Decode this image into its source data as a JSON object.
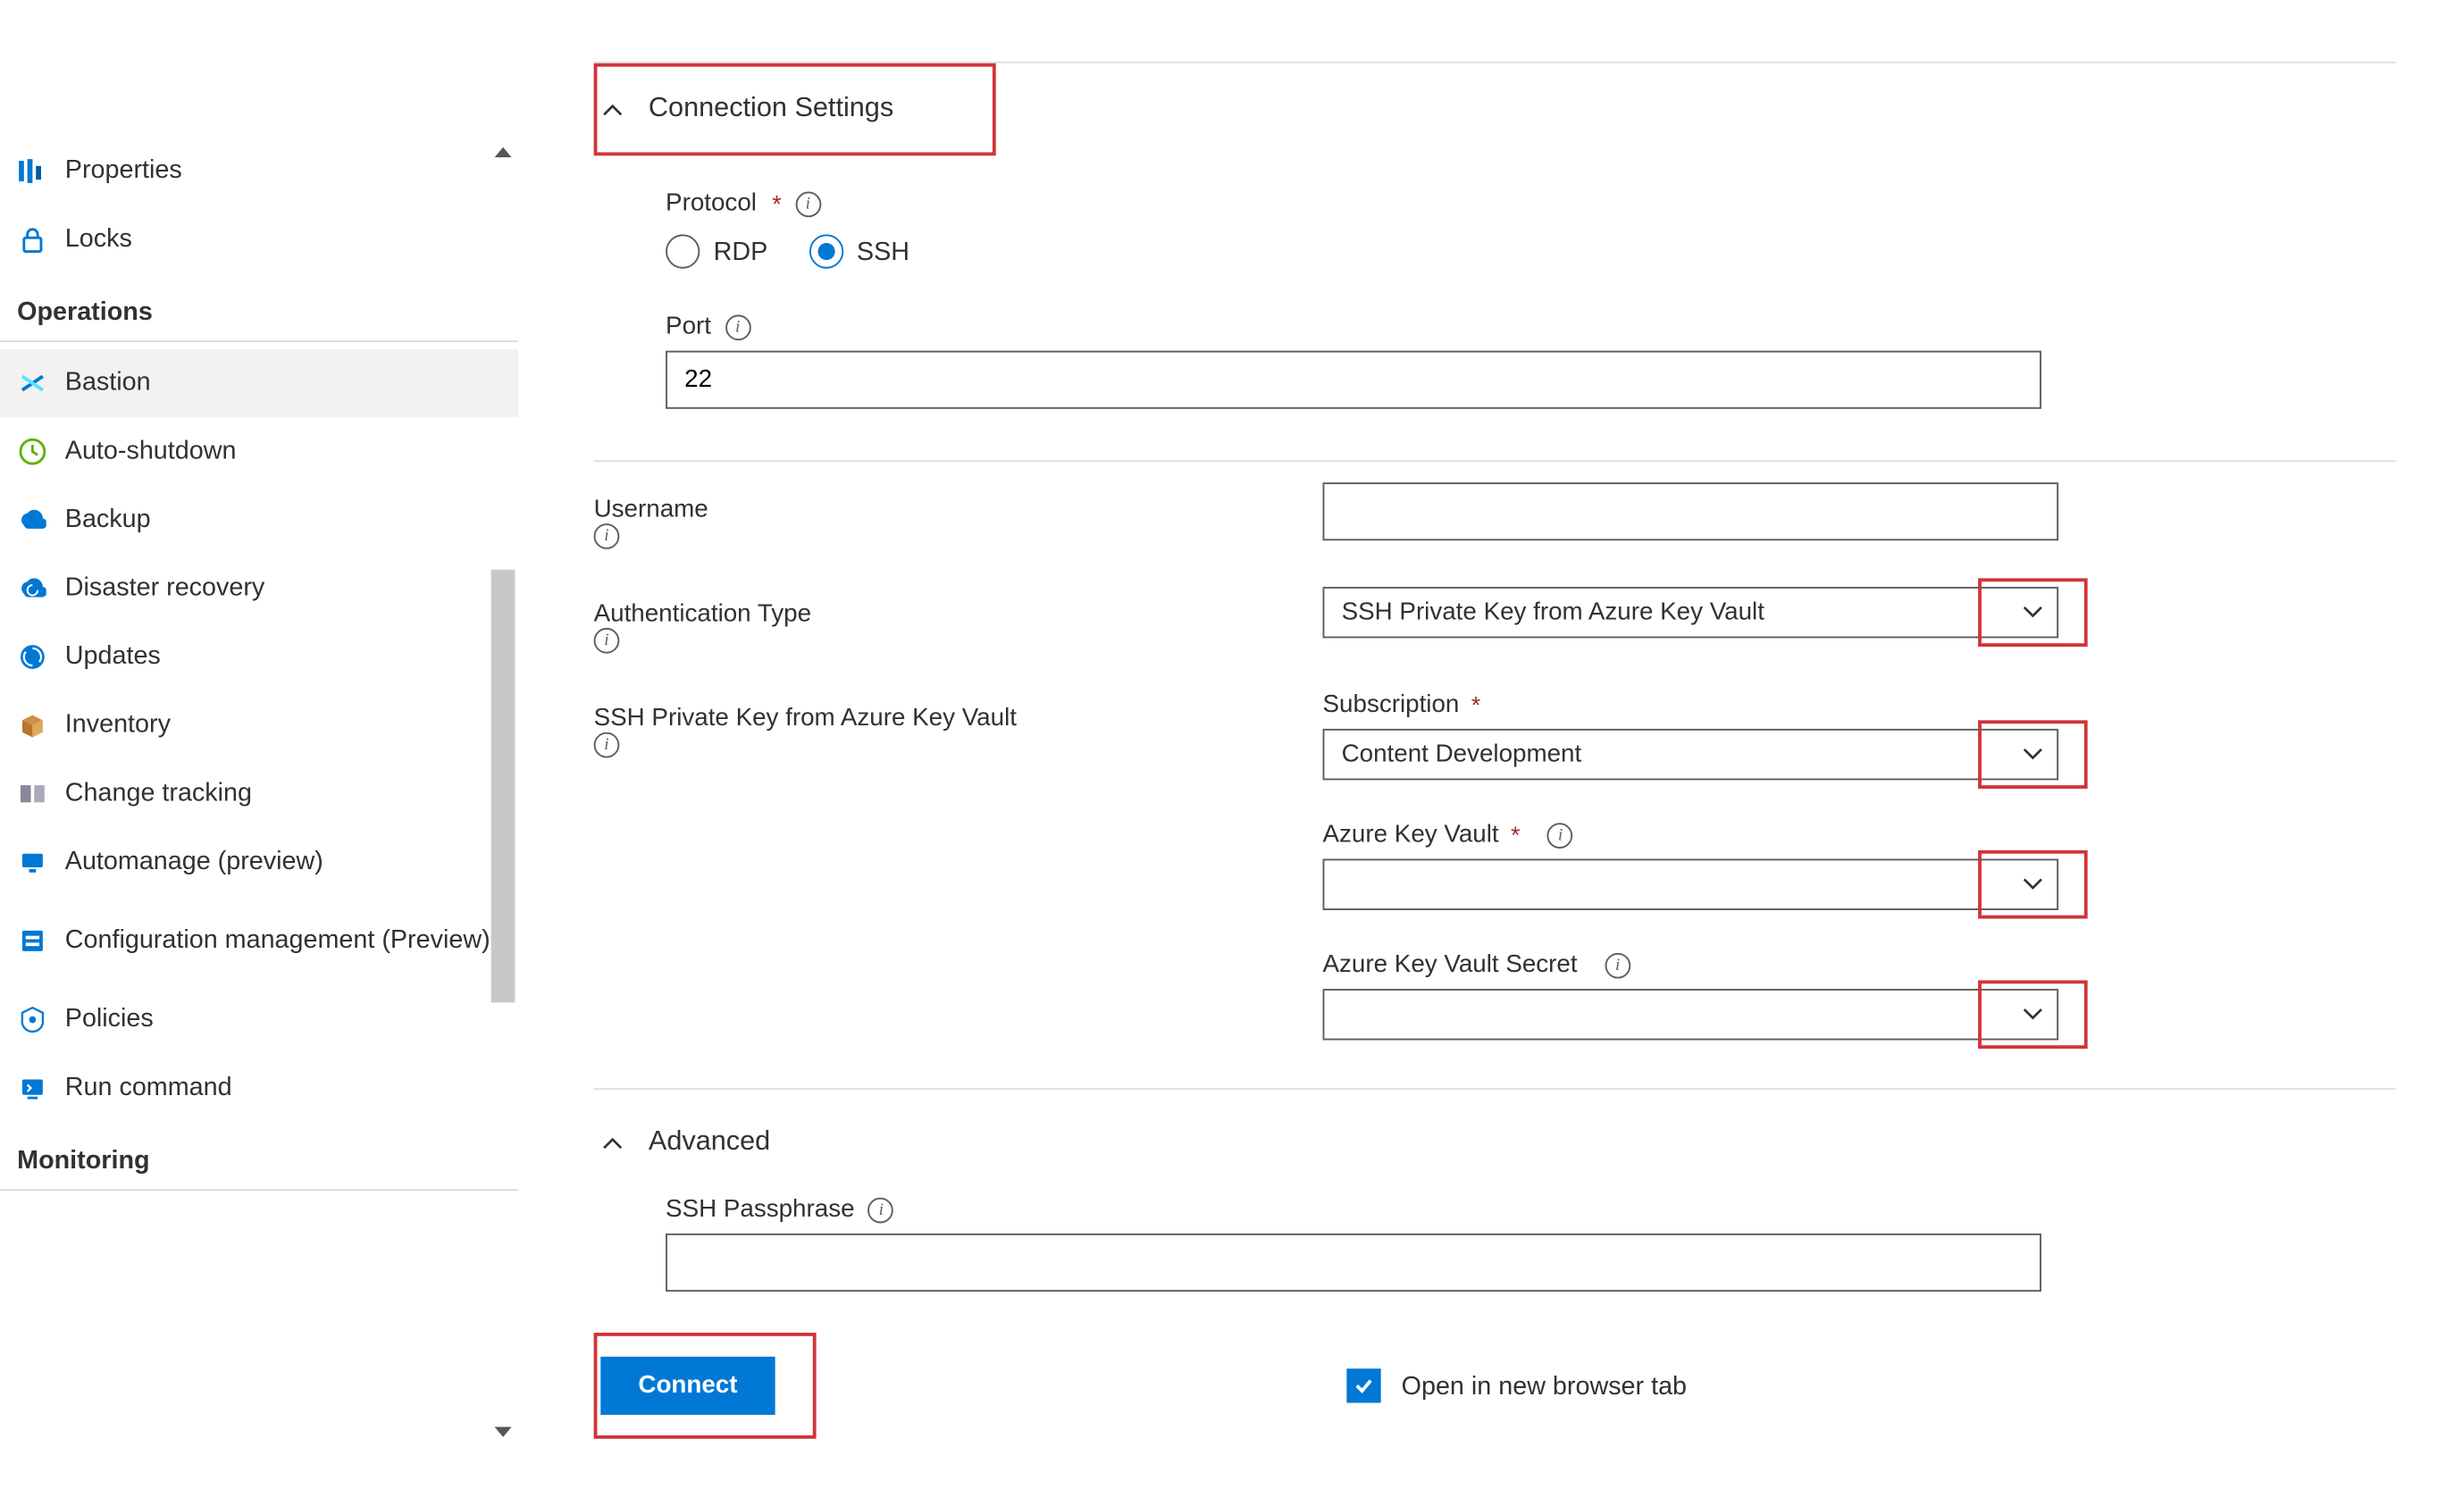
{
  "sidebar": {
    "items_top": [
      {
        "label": "Properties",
        "icon": "properties"
      },
      {
        "label": "Locks",
        "icon": "lock"
      }
    ],
    "group_ops_header": "Operations",
    "items_ops": [
      {
        "label": "Bastion",
        "icon": "bastion"
      },
      {
        "label": "Auto-shutdown",
        "icon": "clock"
      },
      {
        "label": "Backup",
        "icon": "backup"
      },
      {
        "label": "Disaster recovery",
        "icon": "recovery"
      },
      {
        "label": "Updates",
        "icon": "updates"
      },
      {
        "label": "Inventory",
        "icon": "inventory"
      },
      {
        "label": "Change tracking",
        "icon": "change"
      },
      {
        "label": "Automanage (preview)",
        "icon": "automanage"
      },
      {
        "label": "Configuration management (Preview)",
        "icon": "config"
      },
      {
        "label": "Policies",
        "icon": "policies"
      },
      {
        "label": "Run command",
        "icon": "runcmd"
      }
    ],
    "group_monitoring_header": "Monitoring"
  },
  "form": {
    "section_connection_settings": "Connection Settings",
    "protocol_label": "Protocol",
    "protocol_rdp": "RDP",
    "protocol_ssh": "SSH",
    "protocol_selected": "SSH",
    "port_label": "Port",
    "port_value": "22",
    "username_label": "Username",
    "username_value": "",
    "authtype_label": "Authentication Type",
    "authtype_value": "SSH Private Key from Azure Key Vault",
    "sshkey_label": "SSH Private Key from Azure Key Vault",
    "subscription_label": "Subscription",
    "subscription_value": "Content Development",
    "akv_label": "Azure Key Vault",
    "akv_value": "",
    "akv_secret_label": "Azure Key Vault Secret",
    "akv_secret_value": "",
    "section_advanced": "Advanced",
    "ssh_passphrase_label": "SSH Passphrase",
    "ssh_passphrase_value": "",
    "connect_label": "Connect",
    "new_tab_label": "Open in new browser tab",
    "new_tab_checked": true
  }
}
